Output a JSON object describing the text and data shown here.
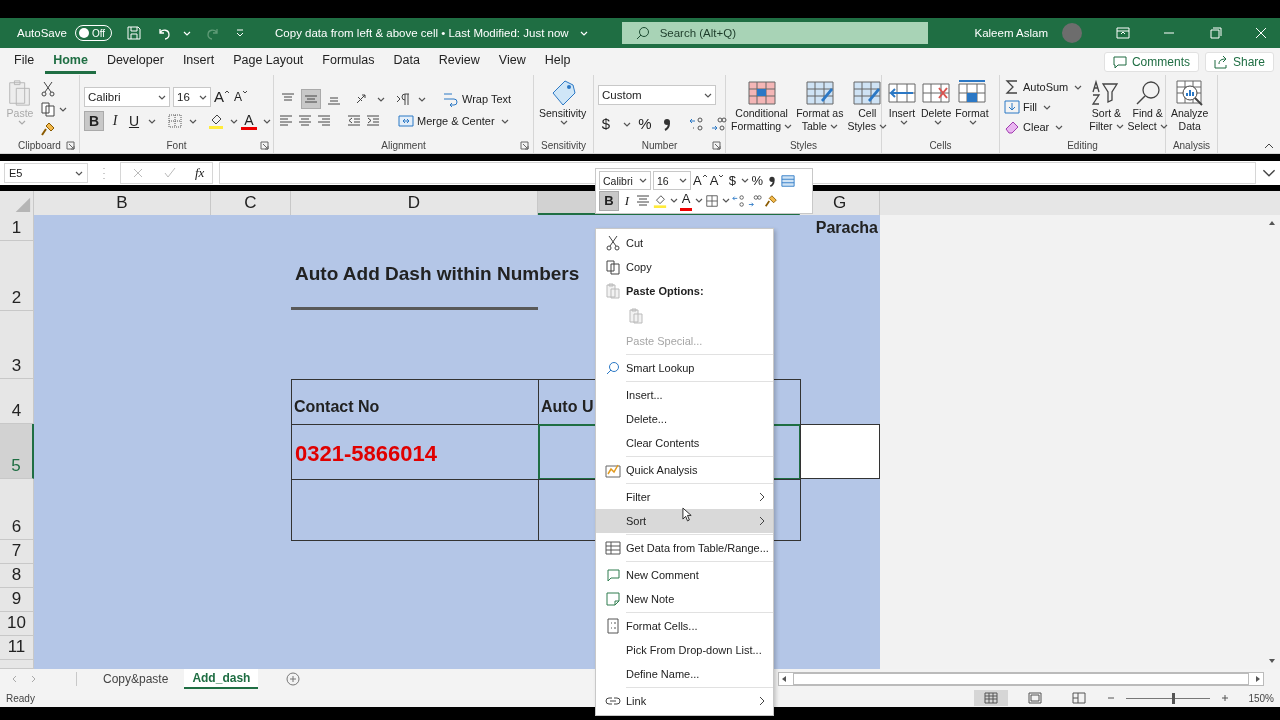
{
  "title_bar": {
    "autosave_label": "AutoSave",
    "autosave": {
      "on": false,
      "label": "Off"
    },
    "document_title": "Copy data from left & above cell • Last Modified: Just now",
    "search_placeholder": "Search (Alt+Q)",
    "user_name": "Kaleem Aslam"
  },
  "menu_tabs": [
    {
      "label": "File",
      "selected": false
    },
    {
      "label": "Home",
      "selected": true
    },
    {
      "label": "Developer",
      "selected": false
    },
    {
      "label": "Insert",
      "selected": false
    },
    {
      "label": "Page Layout",
      "selected": false
    },
    {
      "label": "Formulas",
      "selected": false
    },
    {
      "label": "Data",
      "selected": false
    },
    {
      "label": "Review",
      "selected": false
    },
    {
      "label": "View",
      "selected": false
    },
    {
      "label": "Help",
      "selected": false
    }
  ],
  "comments_button": "Comments",
  "share_button": "Share",
  "ribbon": {
    "clipboard": {
      "name": "Clipboard",
      "paste": "Paste"
    },
    "font": {
      "name": "Font",
      "font_name": "Calibri",
      "font_size": "16",
      "grow": "A",
      "shrink": "A",
      "bold": {
        "label": "B",
        "selected": true
      },
      "italic": "I",
      "underline": "U",
      "font_color": "A"
    },
    "alignment": {
      "name": "Alignment",
      "vertical": [
        {
          "selected": false
        },
        {
          "selected": true
        },
        {
          "selected": false
        }
      ],
      "wrap_text": "Wrap Text",
      "merge_center": "Merge & Center"
    },
    "sensitivity": {
      "name": "Sensitivity",
      "button": "Sensitivity"
    },
    "number": {
      "name": "Number",
      "format": "Custom",
      "currency": "$",
      "percent": "%"
    },
    "styles": {
      "name": "Styles",
      "buttons": [
        [
          "Conditional",
          "Formatting"
        ],
        [
          "Format as",
          "Table"
        ],
        [
          "Cell",
          "Styles"
        ]
      ]
    },
    "cells": {
      "name": "Cells",
      "buttons": [
        "Insert",
        "Delete",
        "Format"
      ]
    },
    "editing": {
      "name": "Editing",
      "autosum": "AutoSum",
      "fill": "Fill",
      "clear": "Clear",
      "buttons": [
        [
          "Sort &",
          "Filter"
        ],
        [
          "Find &",
          "Select"
        ]
      ]
    },
    "analysis": {
      "name": "Analysis",
      "button": [
        "Analyze",
        "Data"
      ]
    }
  },
  "formula_bar": {
    "name_box": "E5",
    "function_label": "fx"
  },
  "columns": [
    {
      "label": "B",
      "selected": false
    },
    {
      "label": "C",
      "selected": false
    },
    {
      "label": "D",
      "selected": false
    },
    {
      "selected": true
    },
    {
      "label": "G",
      "selected": false
    }
  ],
  "rows": [
    {
      "label": "1",
      "selected": false
    },
    {
      "label": "2",
      "selected": false
    },
    {
      "label": "3",
      "selected": false
    },
    {
      "label": "4",
      "selected": false
    },
    {
      "label": "5",
      "selected": true
    },
    {
      "label": "6",
      "selected": false
    },
    {
      "label": "7",
      "selected": false
    },
    {
      "label": "8",
      "selected": false
    },
    {
      "label": "9",
      "selected": false
    },
    {
      "label": "10",
      "selected": false
    },
    {
      "label": "11",
      "selected": false
    }
  ],
  "sheet": {
    "title": "Auto Add Dash within Numbers",
    "side_text": "Paracha",
    "table": {
      "headers": [
        "Contact No",
        "Auto U"
      ],
      "value": "0321-5866014"
    }
  },
  "mini_toolbar": {
    "font_name": "Calibri",
    "font_size": "16",
    "grow": "A",
    "shrink": "A",
    "currency": "$",
    "percent": "%",
    "bold": {
      "label": "B",
      "selected": true
    },
    "italic": "I",
    "font_color": "A"
  },
  "context_menu": {
    "items": [
      {
        "kind": "command",
        "label": "Cut",
        "disabled": false,
        "selected": false,
        "submenu": false
      },
      {
        "kind": "command",
        "label": "Copy",
        "disabled": false,
        "selected": false,
        "submenu": false
      },
      {
        "kind": "header",
        "label": "Paste Options:"
      },
      {
        "kind": "paste-options"
      },
      {
        "kind": "command",
        "label": "Paste Special...",
        "disabled": true,
        "selected": false,
        "submenu": false
      },
      {
        "kind": "separator"
      },
      {
        "kind": "command",
        "label": "Smart Lookup",
        "disabled": false,
        "selected": false,
        "submenu": false
      },
      {
        "kind": "separator"
      },
      {
        "kind": "command",
        "label": "Insert...",
        "disabled": false,
        "selected": false,
        "submenu": false
      },
      {
        "kind": "command",
        "label": "Delete...",
        "disabled": false,
        "selected": false,
        "submenu": false
      },
      {
        "kind": "command",
        "label": "Clear Contents",
        "disabled": false,
        "selected": false,
        "submenu": false
      },
      {
        "kind": "separator"
      },
      {
        "kind": "command",
        "label": "Quick Analysis",
        "disabled": false,
        "selected": false,
        "submenu": false
      },
      {
        "kind": "separator"
      },
      {
        "kind": "command",
        "label": "Filter",
        "disabled": false,
        "selected": false,
        "submenu": true
      },
      {
        "kind": "command",
        "label": "Sort",
        "disabled": false,
        "selected": true,
        "submenu": true
      },
      {
        "kind": "separator"
      },
      {
        "kind": "command",
        "label": "Get Data from Table/Range...",
        "disabled": false,
        "selected": false,
        "submenu": false
      },
      {
        "kind": "separator"
      },
      {
        "kind": "command",
        "label": "New Comment",
        "disabled": false,
        "selected": false,
        "submenu": false
      },
      {
        "kind": "command",
        "label": "New Note",
        "disabled": false,
        "selected": false,
        "submenu": false
      },
      {
        "kind": "separator"
      },
      {
        "kind": "command",
        "label": "Format Cells...",
        "disabled": false,
        "selected": false,
        "submenu": false
      },
      {
        "kind": "command",
        "label": "Pick From Drop-down List...",
        "disabled": false,
        "selected": false,
        "submenu": false
      },
      {
        "kind": "command",
        "label": "Define Name...",
        "disabled": false,
        "selected": false,
        "submenu": false
      },
      {
        "kind": "separator"
      },
      {
        "kind": "command",
        "label": "Link",
        "disabled": false,
        "selected": false,
        "submenu": true
      }
    ]
  },
  "sheet_tabs": [
    {
      "label": "Copy&paste",
      "selected": false
    },
    {
      "label": "Add_dash",
      "selected": true
    }
  ],
  "status_bar": {
    "status": "Ready",
    "views": [
      {
        "selected": true
      },
      {
        "selected": false
      },
      {
        "selected": false
      }
    ],
    "zoom": {
      "label": "150%",
      "level": 0.55
    }
  }
}
